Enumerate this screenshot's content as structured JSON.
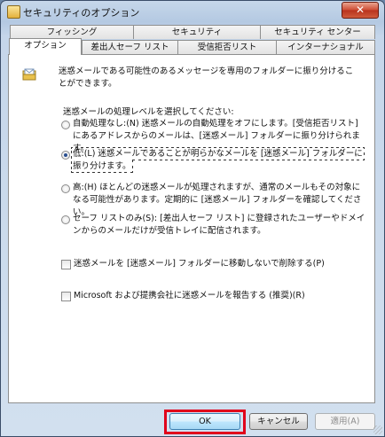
{
  "window": {
    "title": "セキュリティのオプション",
    "close_label": "✕"
  },
  "tabs": {
    "row_back": [
      "フィッシング",
      "セキュリティ",
      "セキュリティ センター"
    ],
    "row_front": [
      "オプション",
      "差出人セーフ リスト",
      "受信拒否リスト",
      "インターナショナル"
    ],
    "active": "オプション"
  },
  "options": {
    "intro": "迷惑メールである可能性のあるメッセージを専用のフォルダーに振り分けることができます。",
    "level_label": "迷惑メールの処理レベルを選択してください:",
    "radio_none": "自動処理なし:(N) 迷惑メールの自動処理をオフにします。[受信拒否リスト] にあるアドレスからのメールは、[迷惑メール] フォルダーに振り分けられます。",
    "radio_low": "低:(L) 迷惑メールであることが明らかなメールを [迷惑メール] フォルダーに振り分けます。",
    "radio_high": "高:(H) ほとんどの迷惑メールが処理されますが、通常のメールもその対象になる可能性があります。定期的に [迷惑メール] フォルダーを確認してください。",
    "radio_safe": "セーフ リストのみ(S): [差出人セーフ リスト] に登録されたユーザーやドメインからのメールだけが受信トレイに配信されます。",
    "selected_level": "low",
    "check_delete": "迷惑メールを [迷惑メール] フォルダーに移動しないで削除する(P)",
    "check_report": "Microsoft および提携会社に迷惑メールを報告する (推奨)(R)"
  },
  "buttons": {
    "ok": "OK",
    "cancel": "キャンセル",
    "apply": "適用(A)"
  },
  "colors": {
    "highlight": "#e0001b",
    "selected_radio": "#2a4f8f"
  },
  "icons": {
    "title": "mail-options-icon",
    "junk": "junk-mail-folder-icon",
    "close": "close-icon"
  }
}
